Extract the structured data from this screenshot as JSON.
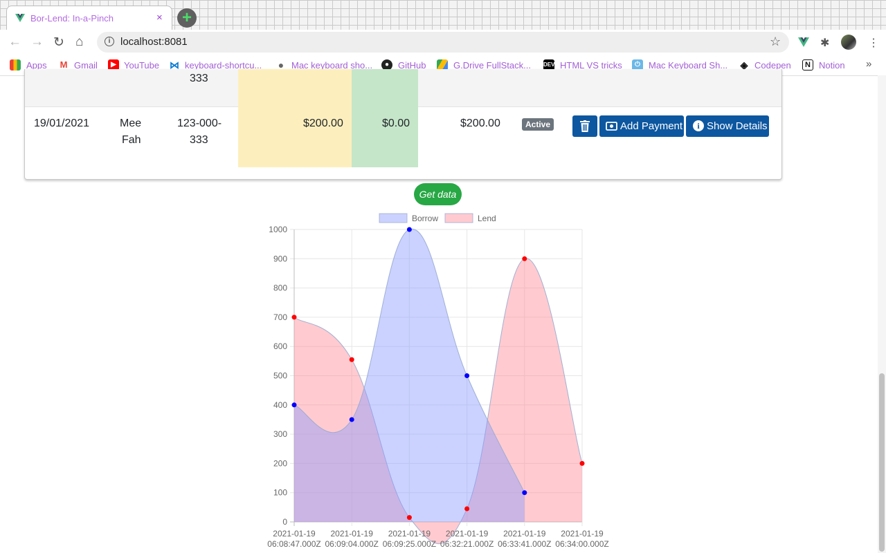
{
  "browser": {
    "tab_title": "Bor-Lend: In-a-Pinch",
    "tab_close": "×",
    "new_tab": "+",
    "url": "localhost:8081",
    "bookmarks": [
      "Apps",
      "Gmail",
      "YouTube",
      "keyboard-shortcu...",
      "Mac keyboard sho...",
      "GitHub",
      "G.Drive FullStack...",
      "HTML VS tricks",
      "Mac Keyboard Sh...",
      "Codepen",
      "Notion"
    ],
    "more": "»"
  },
  "table": {
    "prev_row_phone_tail": "333",
    "row": {
      "date": "19/01/2021",
      "name": [
        "Mee",
        "Fah"
      ],
      "phone": [
        "123-000-",
        "333"
      ],
      "borrow": "$200.00",
      "paid": "$0.00",
      "remaining": "$200.00",
      "status": "Active"
    },
    "buttons": {
      "delete_icon": "trash-icon",
      "add_payment": "Add Payment",
      "show_details": "Show Details"
    }
  },
  "actions": {
    "get_data": "Get data"
  },
  "chart_data": {
    "type": "line",
    "title": "",
    "x": [
      "2021-01-19 06:08:47.000Z",
      "2021-01-19 06:09:04.000Z",
      "2021-01-19 06:09:25.000Z",
      "2021-01-19 06:32:21.000Z",
      "2021-01-19 06:33:41.000Z",
      "2021-01-19 06:34:00.000Z"
    ],
    "series": [
      {
        "name": "Borrow",
        "values": [
          400,
          350,
          1000,
          500,
          100,
          null
        ],
        "color": "#0000ff",
        "fill": "rgba(140,155,255,0.45)"
      },
      {
        "name": "Lend",
        "values": [
          700,
          555,
          15,
          45,
          900,
          200
        ],
        "color": "#ff0000",
        "fill": "rgba(255,140,150,0.45)"
      }
    ],
    "ylim": [
      0,
      1000
    ],
    "yticks": [
      0,
      100,
      200,
      300,
      400,
      500,
      600,
      700,
      800,
      900,
      1000
    ],
    "grid": true,
    "legend": "top",
    "area": true
  }
}
